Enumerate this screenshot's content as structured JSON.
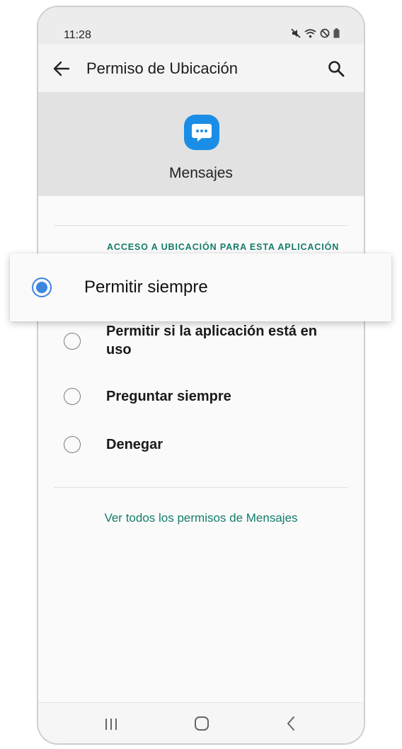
{
  "status_bar": {
    "time": "11:28"
  },
  "app_bar": {
    "title": "Permiso de Ubicación"
  },
  "app": {
    "name": "Mensajes"
  },
  "section": {
    "label": "ACCESO A UBICACIÓN PARA ESTA APLICACIÓN"
  },
  "options": [
    {
      "label": "Permitir siempre",
      "selected": true
    },
    {
      "label": "Permitir si la aplicación está en uso",
      "selected": false
    },
    {
      "label": "Preguntar siempre",
      "selected": false
    },
    {
      "label": "Denegar",
      "selected": false
    }
  ],
  "links": {
    "see_all": "Ver todos los permisos de Mensajes"
  },
  "colors": {
    "accent": "#137c6a",
    "radio_selected": "#3b86e0",
    "app_icon": "#1a8ee6"
  },
  "icons": [
    "back-arrow-icon",
    "search-icon",
    "chat-bubble-icon",
    "mute-icon",
    "wifi-icon",
    "do-not-disturb-icon",
    "battery-icon",
    "recent-apps-icon",
    "home-icon",
    "nav-back-icon"
  ]
}
